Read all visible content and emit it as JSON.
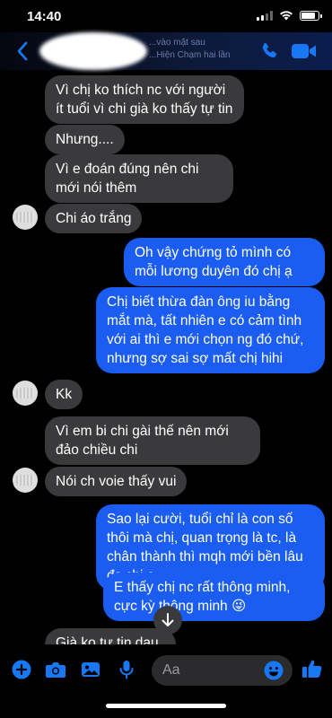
{
  "status": {
    "time": "14:40"
  },
  "header": {
    "subtitle_line1": "...vào mặt sau",
    "subtitle_line2": "...Hiện Chạm hai lần"
  },
  "messages": [
    {
      "side": "in",
      "text": "Vì chị ko thích nc với người ít tuổi vì chi già ko thấy tự tin"
    },
    {
      "side": "in",
      "text": "Nhưng...."
    },
    {
      "side": "in",
      "text": "Vì e đoán đúng nên chi mới nói thêm"
    },
    {
      "side": "in",
      "text": "Chi áo trắng"
    },
    {
      "side": "out",
      "text": "Oh vậy chứng tỏ mình có mỗi lương duyên đó chị ạ"
    },
    {
      "side": "out",
      "text": "Chị biết thừa đàn ông iu bằng mắt mà, tất nhiên e có cảm tình với ai thì e mới chọn ng đó chứ, nhưng sợ sai sợ mất chị hihi"
    },
    {
      "side": "in",
      "text": "Kk"
    },
    {
      "side": "in",
      "text": "Vì em bi chi gài thế nên mới đảo chiều chi"
    },
    {
      "side": "in",
      "text": "Nói ch voie thấy vui"
    },
    {
      "side": "out",
      "text": "Sao lại cười, tuổi chỉ là con số thôi mà chị, quan trọng là tc, là chân thành thì mqh mới bền lâu đc chị ạ"
    },
    {
      "side": "out",
      "text": "E thấy chị nc rất thông minh, cực kỳ thông minh 😜"
    },
    {
      "side": "in",
      "text": "Già ko tư tin dau e"
    }
  ],
  "composer": {
    "placeholder": "Aa"
  },
  "colors": {
    "outgoing": "#1a5df0",
    "incoming": "#3a3a3c",
    "accent": "#1877f2"
  }
}
